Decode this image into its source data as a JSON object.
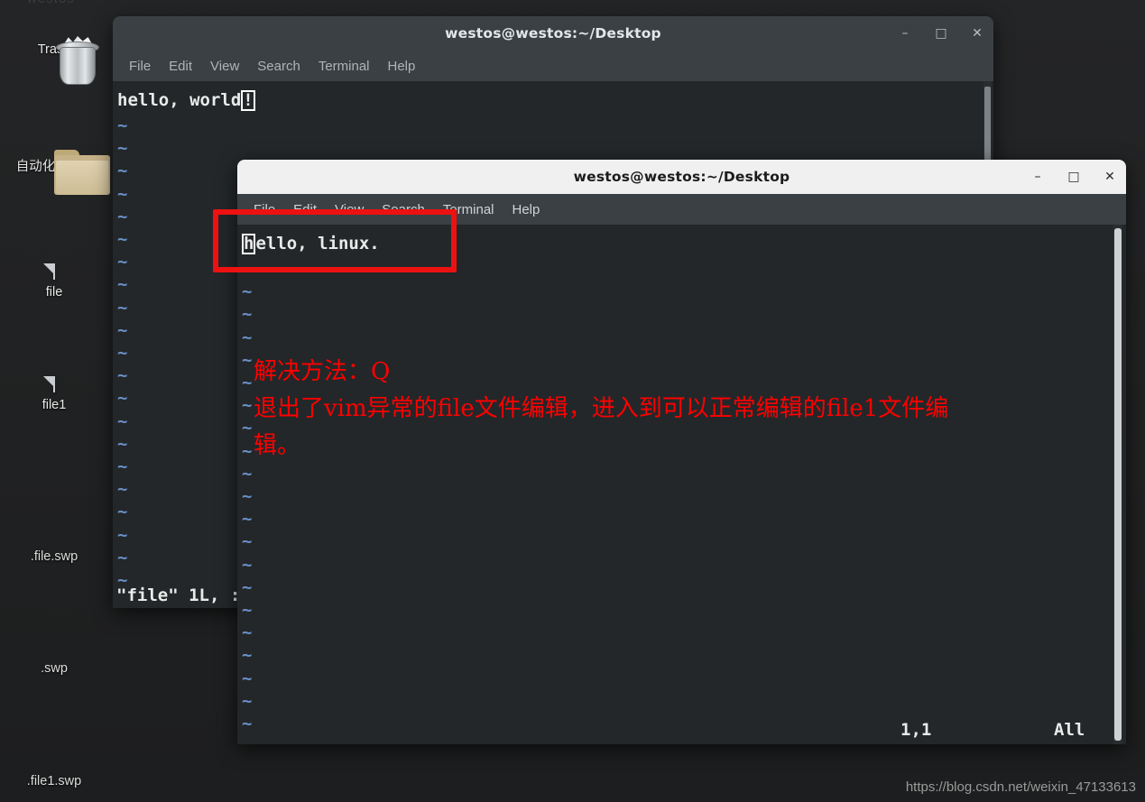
{
  "desktop": {
    "top_cut_text": "westos",
    "icons": [
      {
        "name": "trash",
        "label": "Trash",
        "icon": "trash-icon"
      },
      {
        "name": "folder",
        "label": "自动化运维...",
        "icon": "folder-icon"
      },
      {
        "name": "file",
        "label": "file",
        "icon": "document-icon"
      },
      {
        "name": "file1",
        "label": "file1",
        "icon": "document-icon"
      }
    ],
    "text_labels": [
      {
        "name": "file-swp",
        "label": ".file.swp"
      },
      {
        "name": "swp",
        "label": ".swp"
      },
      {
        "name": "file1-swp",
        "label": ".file1.swp"
      }
    ]
  },
  "window1": {
    "title": "westos@westos:~/Desktop",
    "menus": [
      "File",
      "Edit",
      "View",
      "Search",
      "Terminal",
      "Help"
    ],
    "buttons": {
      "minimize": "–",
      "maximize": "□",
      "close": "✕"
    },
    "editor": {
      "line1_before_cursor": "hello, world",
      "line1_cursor_char": "!",
      "tilde": "~",
      "tilde_count": 22,
      "status": "\"file\" 1L, :"
    }
  },
  "window2": {
    "title": "westos@westos:~/Desktop",
    "menus": [
      "File",
      "Edit",
      "View",
      "Search",
      "Terminal",
      "Help"
    ],
    "buttons": {
      "minimize": "–",
      "maximize": "□",
      "close": "✕"
    },
    "editor": {
      "line1_cursor_char": "h",
      "line1_after_cursor": "ello, linux.",
      "tilde": "~",
      "tilde_count": 22,
      "status_position": "1,1",
      "status_scroll": "All"
    },
    "annotation": {
      "line1": "解决方法：Q",
      "line2": "退出了vim异常的file文件编辑，进入到可以正常编辑的file1文件编",
      "line3": "辑。",
      "color": "#ff0000"
    }
  },
  "highlight_box": {
    "color": "#ee1111"
  },
  "watermark": "https://blog.csdn.net/weixin_47133613",
  "colors": {
    "desktop_bg": "#232425",
    "titlebar_inactive": "#3b4044",
    "titlebar_active": "#f0f0f0",
    "terminal_bg": "#232729",
    "terminal_fg": "#e9eaea",
    "tilde_blue": "#6a8fc7",
    "annotation_red": "#ff0000"
  }
}
